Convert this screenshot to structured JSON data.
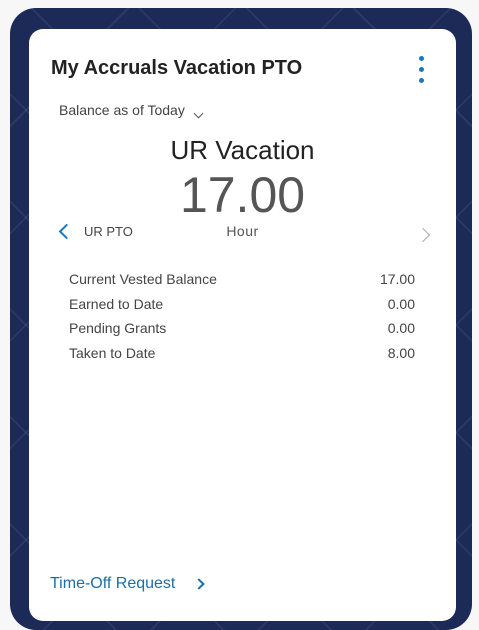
{
  "card": {
    "title": "My Accruals Vacation PTO",
    "menu_icon": "more-vertical-icon",
    "filter_label": "Balance as of Today",
    "plan_name": "UR Vacation",
    "balance": "17.00",
    "unit": "Hour",
    "prev_plan": "UR PTO",
    "details": [
      {
        "label": "Current Vested Balance",
        "value": "17.00"
      },
      {
        "label": "Earned to Date",
        "value": "0.00"
      },
      {
        "label": "Pending Grants",
        "value": "0.00"
      },
      {
        "label": "Taken to Date",
        "value": "8.00"
      }
    ],
    "request_link": "Time-Off Request"
  },
  "colors": {
    "frame": "#1b2a57",
    "accent": "#1a78c2",
    "link": "#1c6ea8"
  }
}
